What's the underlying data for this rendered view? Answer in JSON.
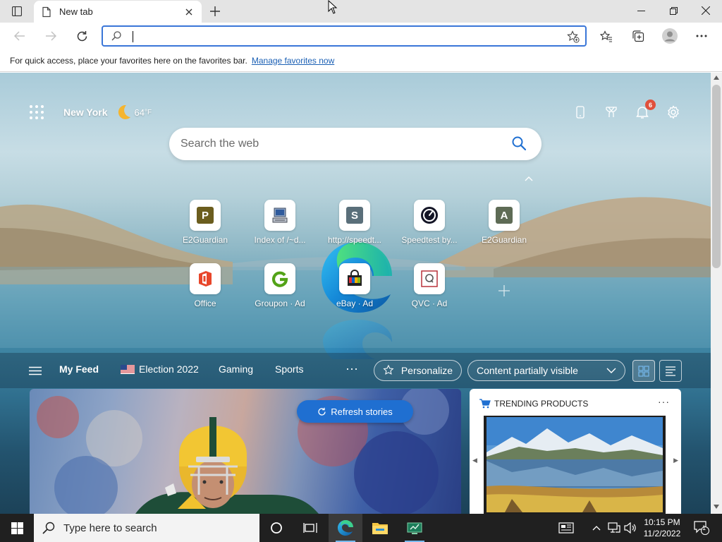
{
  "tab": {
    "title": "New tab"
  },
  "address_bar": {
    "value": "",
    "placeholder": ""
  },
  "favorites_bar": {
    "message": "For quick access, place your favorites here on the favorites bar.",
    "link": "Manage favorites now"
  },
  "weather": {
    "city": "New York",
    "temp": "64",
    "unit": "°F"
  },
  "notifications": {
    "count": "6"
  },
  "search": {
    "placeholder": "Search the web"
  },
  "quick_links": [
    {
      "label": "E2Guardian",
      "icon": "letter-P-icon",
      "letter": "P",
      "color": "#6b5d1e"
    },
    {
      "label": "Index of /~d...",
      "icon": "computer-icon"
    },
    {
      "label": "http://speedt...",
      "icon": "letter-S-icon",
      "letter": "S",
      "color": "#5a6f7a"
    },
    {
      "label": "Speedtest by...",
      "icon": "speedometer-icon"
    },
    {
      "label": "E2Guardian",
      "icon": "letter-A-icon",
      "letter": "A",
      "color": "#5e6b55"
    },
    {
      "label": "Office",
      "icon": "office-icon"
    },
    {
      "label": "Groupon · Ad",
      "icon": "groupon-icon"
    },
    {
      "label": "eBay · Ad",
      "icon": "ebay-bag-icon"
    },
    {
      "label": "QVC · Ad",
      "icon": "qvc-icon"
    }
  ],
  "feed_nav": {
    "items": [
      "My Feed",
      "Election 2022",
      "Gaming",
      "Sports"
    ],
    "more": "···",
    "personalize": "Personalize",
    "content_visibility": "Content partially visible"
  },
  "refresh": {
    "label": "Refresh stories"
  },
  "trending": {
    "title": "TRENDING PRODUCTS",
    "more": "···"
  },
  "taskbar": {
    "search_placeholder": "Type here to search",
    "time": "10:15 PM",
    "date": "11/2/2022",
    "notification_count": "1"
  },
  "colors": {
    "accent": "#1f6fd1",
    "edge_blue": "#0a78d4",
    "taskbar": "#202020"
  }
}
